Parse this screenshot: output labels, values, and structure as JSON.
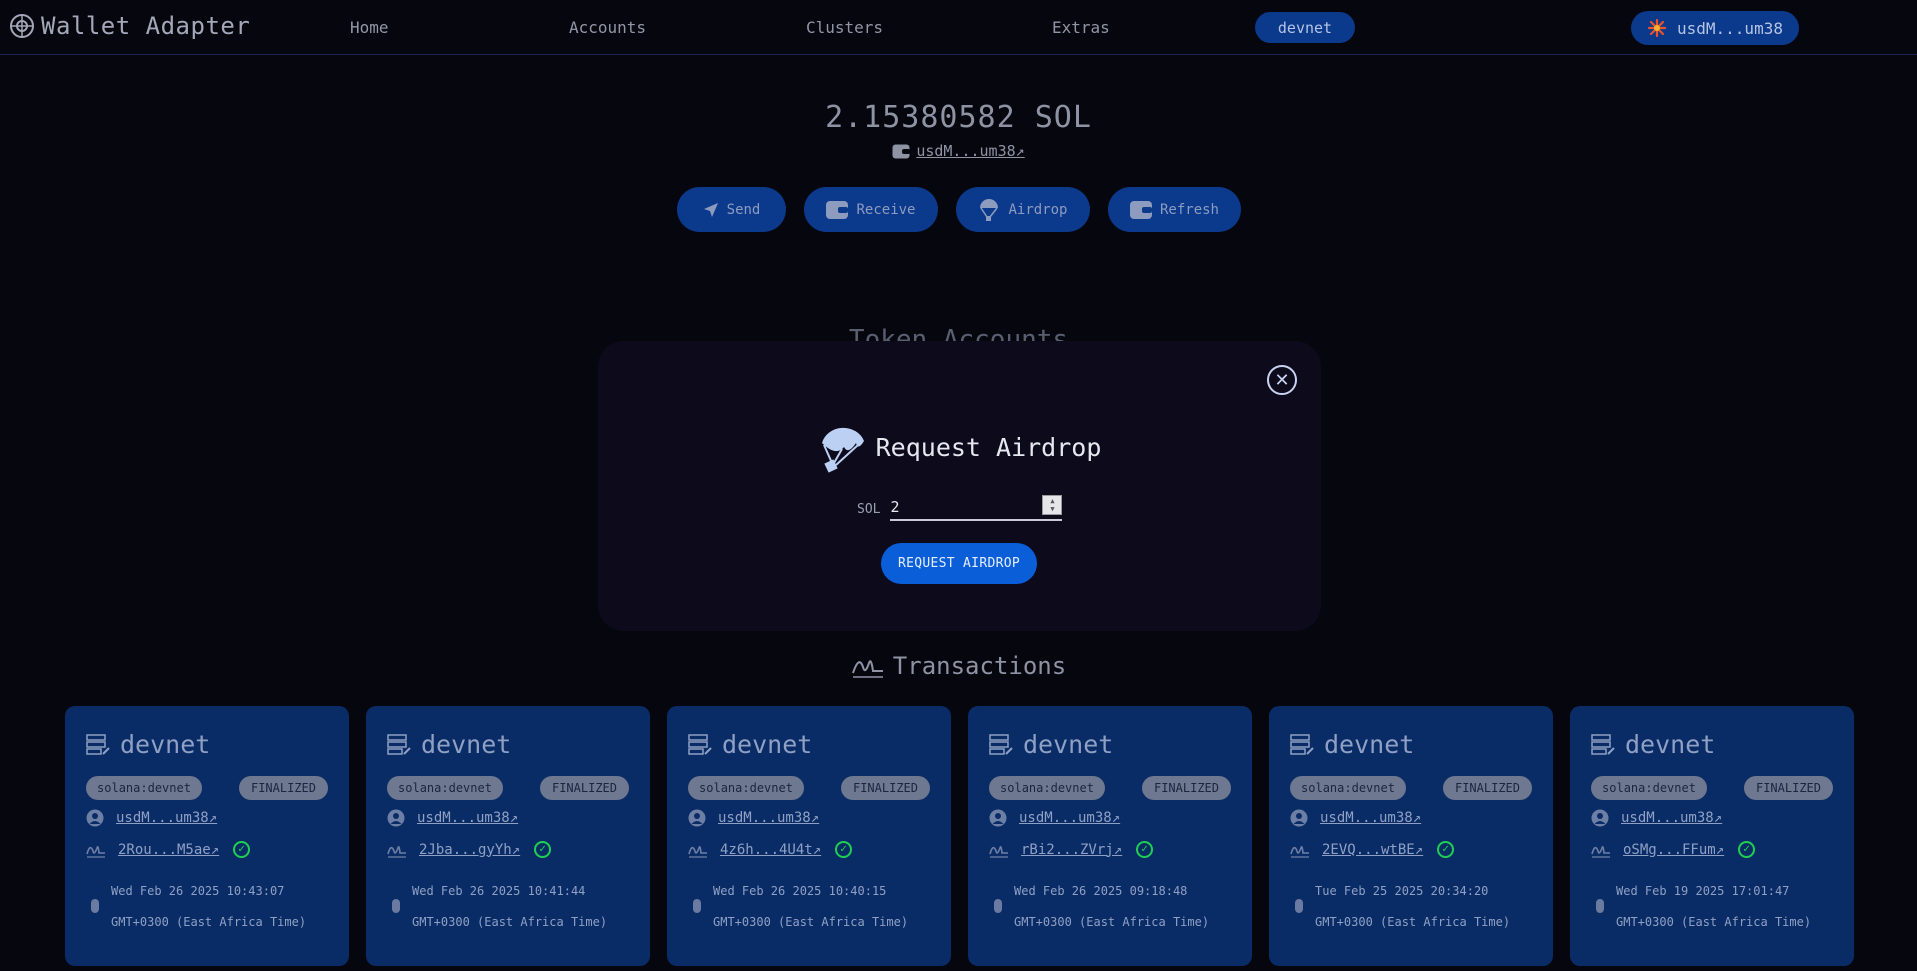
{
  "nav": {
    "brand": "Wallet Adapter",
    "links": [
      "Home",
      "Accounts",
      "Clusters",
      "Extras"
    ],
    "cluster": "devnet",
    "wallet": "usdM...um38"
  },
  "balance": {
    "amount": "2.15380582 SOL",
    "address": "usdM...um38↗"
  },
  "actions": [
    "Send",
    "Receive",
    "Airdrop",
    "Refresh"
  ],
  "token_accounts_title": "Token Accounts",
  "modal": {
    "title": "Request Airdrop",
    "sol_label": "SOL",
    "sol_value": "2",
    "button": "REQUEST AIRDROP"
  },
  "transactions": {
    "title": "Transactions",
    "cards": [
      {
        "network": "devnet",
        "chain": "solana:devnet",
        "status": "FINALIZED",
        "account": "usdM...um38↗",
        "signature": "2Rou...M5ae↗",
        "date": "Wed Feb 26 2025 10:43:07",
        "tz": "GMT+0300 (East Africa Time)"
      },
      {
        "network": "devnet",
        "chain": "solana:devnet",
        "status": "FINALIZED",
        "account": "usdM...um38↗",
        "signature": "2Jba...gyYh↗",
        "date": "Wed Feb 26 2025 10:41:44",
        "tz": "GMT+0300 (East Africa Time)"
      },
      {
        "network": "devnet",
        "chain": "solana:devnet",
        "status": "FINALIZED",
        "account": "usdM...um38↗",
        "signature": "4z6h...4U4t↗",
        "date": "Wed Feb 26 2025 10:40:15",
        "tz": "GMT+0300 (East Africa Time)"
      },
      {
        "network": "devnet",
        "chain": "solana:devnet",
        "status": "FINALIZED",
        "account": "usdM...um38↗",
        "signature": "rBi2...ZVrj↗",
        "date": "Wed Feb 26 2025 09:18:48",
        "tz": "GMT+0300 (East Africa Time)"
      },
      {
        "network": "devnet",
        "chain": "solana:devnet",
        "status": "FINALIZED",
        "account": "usdM...um38↗",
        "signature": "2EVQ...wtBE↗",
        "date": "Tue Feb 25 2025 20:34:20",
        "tz": "GMT+0300 (East Africa Time)"
      },
      {
        "network": "devnet",
        "chain": "solana:devnet",
        "status": "FINALIZED",
        "account": "usdM...um38↗",
        "signature": "oSMg...FFum↗",
        "date": "Wed Feb 19 2025 17:01:47",
        "tz": "GMT+0300 (East Africa Time)"
      }
    ]
  },
  "colors": {
    "background": "#06060f",
    "accent": "#0a5fd9",
    "pill": "#0b3a8c",
    "card": "#0a2c66",
    "success": "#1fcf52"
  }
}
